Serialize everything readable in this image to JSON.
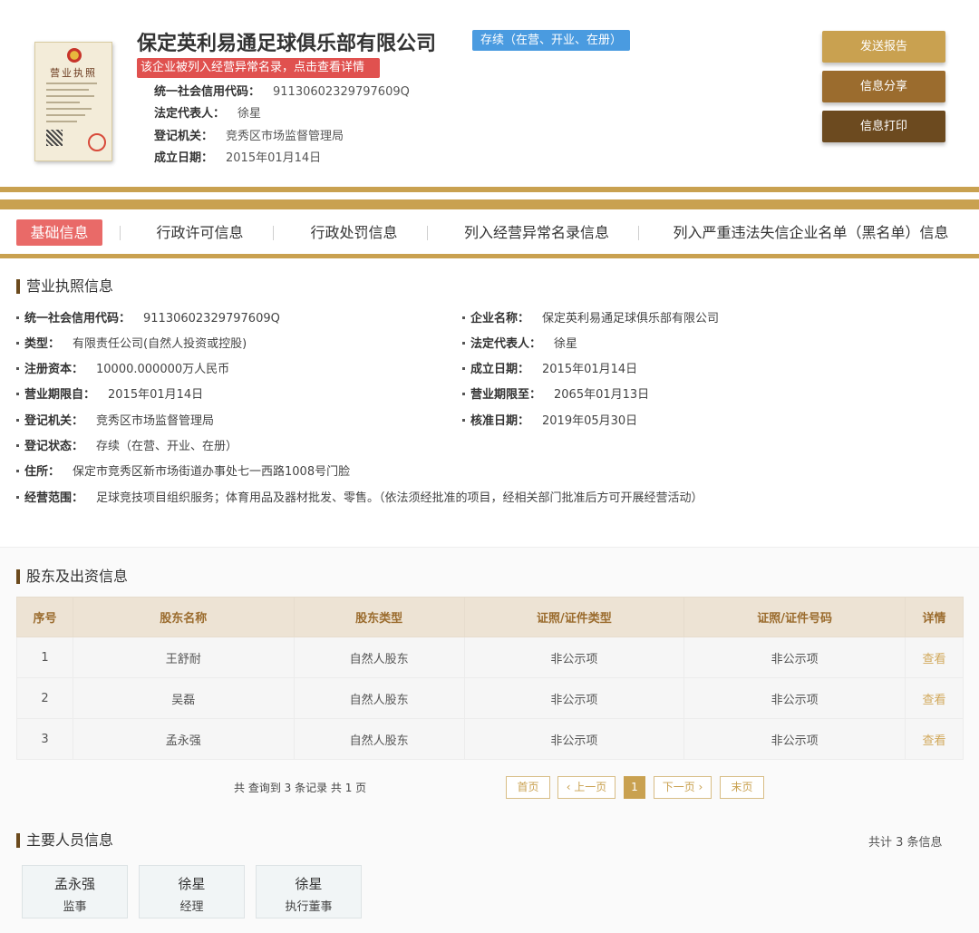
{
  "header": {
    "license_image_title": "营业执照",
    "company_name": "保定英利易通足球俱乐部有限公司",
    "status_tag": "存续（在营、开业、在册）",
    "abnormal_notice": "该企业被列入经营异常名录，点击查看详情",
    "rows": [
      {
        "label": "统一社会信用代码：",
        "value": "91130602329797609Q"
      },
      {
        "label": "法定代表人：",
        "value": "徐星"
      },
      {
        "label": "登记机关：",
        "value": "竞秀区市场监督管理局"
      },
      {
        "label": "成立日期：",
        "value": "2015年01月14日"
      }
    ]
  },
  "actions": {
    "send_report": "发送报告",
    "share": "信息分享",
    "print": "信息打印"
  },
  "colors": {
    "gold": "#c9a150",
    "brown": "#9b6c2e",
    "dark_brown": "#6c4a1f",
    "active_tab": "#e96a68",
    "status_blue": "#4a9be0",
    "alert_red": "#e0514f"
  },
  "tabs": [
    {
      "label": "基础信息",
      "active": true
    },
    {
      "label": "行政许可信息",
      "active": false
    },
    {
      "label": "行政处罚信息",
      "active": false
    },
    {
      "label": "列入经营异常名录信息",
      "active": false
    },
    {
      "label": "列入严重违法失信企业名单（黑名单）信息",
      "active": false
    }
  ],
  "license_section": {
    "title": "营业执照信息",
    "fields": {
      "credit_code": {
        "label": "统一社会信用代码：",
        "value": "91130602329797609Q"
      },
      "company_name": {
        "label": "企业名称：",
        "value": "保定英利易通足球俱乐部有限公司"
      },
      "type": {
        "label": "类型：",
        "value": "有限责任公司(自然人投资或控股)"
      },
      "legal_rep": {
        "label": "法定代表人：",
        "value": "徐星"
      },
      "capital": {
        "label": "注册资本：",
        "value": "10000.000000万人民币"
      },
      "founded": {
        "label": "成立日期：",
        "value": "2015年01月14日"
      },
      "term_from": {
        "label": "营业期限自：",
        "value": "2015年01月14日"
      },
      "term_to": {
        "label": "营业期限至：",
        "value": "2065年01月13日"
      },
      "authority": {
        "label": "登记机关：",
        "value": "竞秀区市场监督管理局"
      },
      "approved": {
        "label": "核准日期：",
        "value": "2019年05月30日"
      },
      "status": {
        "label": "登记状态：",
        "value": "存续（在营、开业、在册）"
      },
      "address": {
        "label": "住所：",
        "value": "保定市竞秀区新市场街道办事处七一西路1008号门脸"
      },
      "scope": {
        "label": "经营范围：",
        "value": "足球竞技项目组织服务；体育用品及器材批发、零售。（依法须经批准的项目，经相关部门批准后方可开展经营活动）"
      }
    }
  },
  "shareholders": {
    "title": "股东及出资信息",
    "columns": [
      "序号",
      "股东名称",
      "股东类型",
      "证照/证件类型",
      "证照/证件号码",
      "详情"
    ],
    "rows": [
      [
        "1",
        "王舒耐",
        "自然人股东",
        "非公示项",
        "非公示项",
        "查看"
      ],
      [
        "2",
        "吴磊",
        "自然人股东",
        "非公示项",
        "非公示项",
        "查看"
      ],
      [
        "3",
        "孟永强",
        "自然人股东",
        "非公示项",
        "非公示项",
        "查看"
      ]
    ],
    "summary": "共 查询到 3 条记录 共 1 页",
    "pager": {
      "first": "首页",
      "prev": "‹ 上一页",
      "current": "1",
      "next": "下一页 ›",
      "last": "末页"
    }
  },
  "personnel": {
    "title": "主要人员信息",
    "count_text": "共计 3 条信息",
    "people": [
      {
        "name": "孟永强",
        "role": "监事"
      },
      {
        "name": "徐星",
        "role": "经理"
      },
      {
        "name": "徐星",
        "role": "执行董事"
      }
    ]
  }
}
